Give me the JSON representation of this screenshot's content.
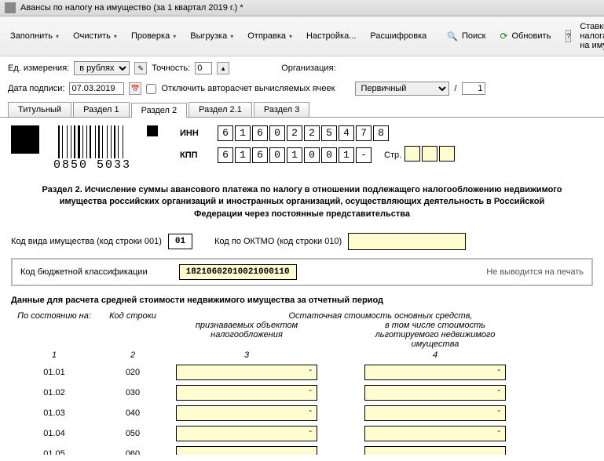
{
  "window_title": "Авансы по налогу на имущество (за 1 квартал 2019 г.) *",
  "toolbar": {
    "fill": "Заполнить",
    "clear": "Очистить",
    "check": "Проверка",
    "upload": "Выгрузка",
    "send": "Отправка",
    "setup": "Настройка...",
    "decode": "Расшифровка",
    "search": "Поиск",
    "refresh": "Обновить",
    "rates": "Ставки налога на иму"
  },
  "params": {
    "unit_label": "Ед. измерения:",
    "unit_value": "в рублях",
    "precision_label": "Точность:",
    "precision_value": "0",
    "org_label": "Организация:",
    "date_label": "Дата подписи:",
    "date_value": "07.03.2019",
    "disable_label": "Отключить авторасчет вычисляемых ячеек",
    "doc_type": "Первичный",
    "slash_value": "1"
  },
  "tabs": [
    "Титульный",
    "Раздел 1",
    "Раздел 2",
    "Раздел 2.1",
    "Раздел 3"
  ],
  "active_tab": 2,
  "barcode_text": "0850 5033",
  "inn_label": "ИНН",
  "inn": [
    "6",
    "1",
    "6",
    "0",
    "2",
    "2",
    "5",
    "4",
    "7",
    "8"
  ],
  "kpp_label": "КПП",
  "kpp": [
    "6",
    "1",
    "6",
    "0",
    "1",
    "0",
    "0",
    "1",
    "-"
  ],
  "page_label": "Стр.",
  "page_cells": [
    "",
    "",
    ""
  ],
  "section_title": "Раздел 2. Исчисление суммы авансового платежа по налогу в отношении подлежащего налогообложению недвижимого имущества российских организаций и иностранных организаций, осуществляющих деятельность в Российской Федерации через постоянные представительства",
  "prop_code_label": "Код вида имущества (код строки 001)",
  "prop_code_value": "01",
  "oktmo_label": "Код по ОКТМО (код строки 010)",
  "kbk_label": "Код бюджетной классификации",
  "kbk_value": "18210602010021000110",
  "kbk_note": "Не выводится на печать",
  "subtitle": "Данные для расчета средней стоимости недвижимого имущества за отчетный период",
  "thead": {
    "c1": "По состоянию на:",
    "c2": "Код строки",
    "c3a": "Остаточная стоимость основных средств,",
    "c3": "признаваемых объектом налогообложения",
    "c5": "в том числе стоимость льготируемого недвижимого имущества"
  },
  "tnum": {
    "c1": "1",
    "c2": "2",
    "c3": "3",
    "c5": "4"
  },
  "rows": [
    {
      "date": "01.01",
      "code": "020",
      "v1": "-",
      "v2": "-"
    },
    {
      "date": "01.02",
      "code": "030",
      "v1": "-",
      "v2": "-"
    },
    {
      "date": "01.03",
      "code": "040",
      "v1": "-",
      "v2": "-"
    },
    {
      "date": "01.04",
      "code": "050",
      "v1": "-",
      "v2": "-"
    },
    {
      "date": "01.05",
      "code": "060",
      "v1": "",
      "v2": ""
    }
  ]
}
